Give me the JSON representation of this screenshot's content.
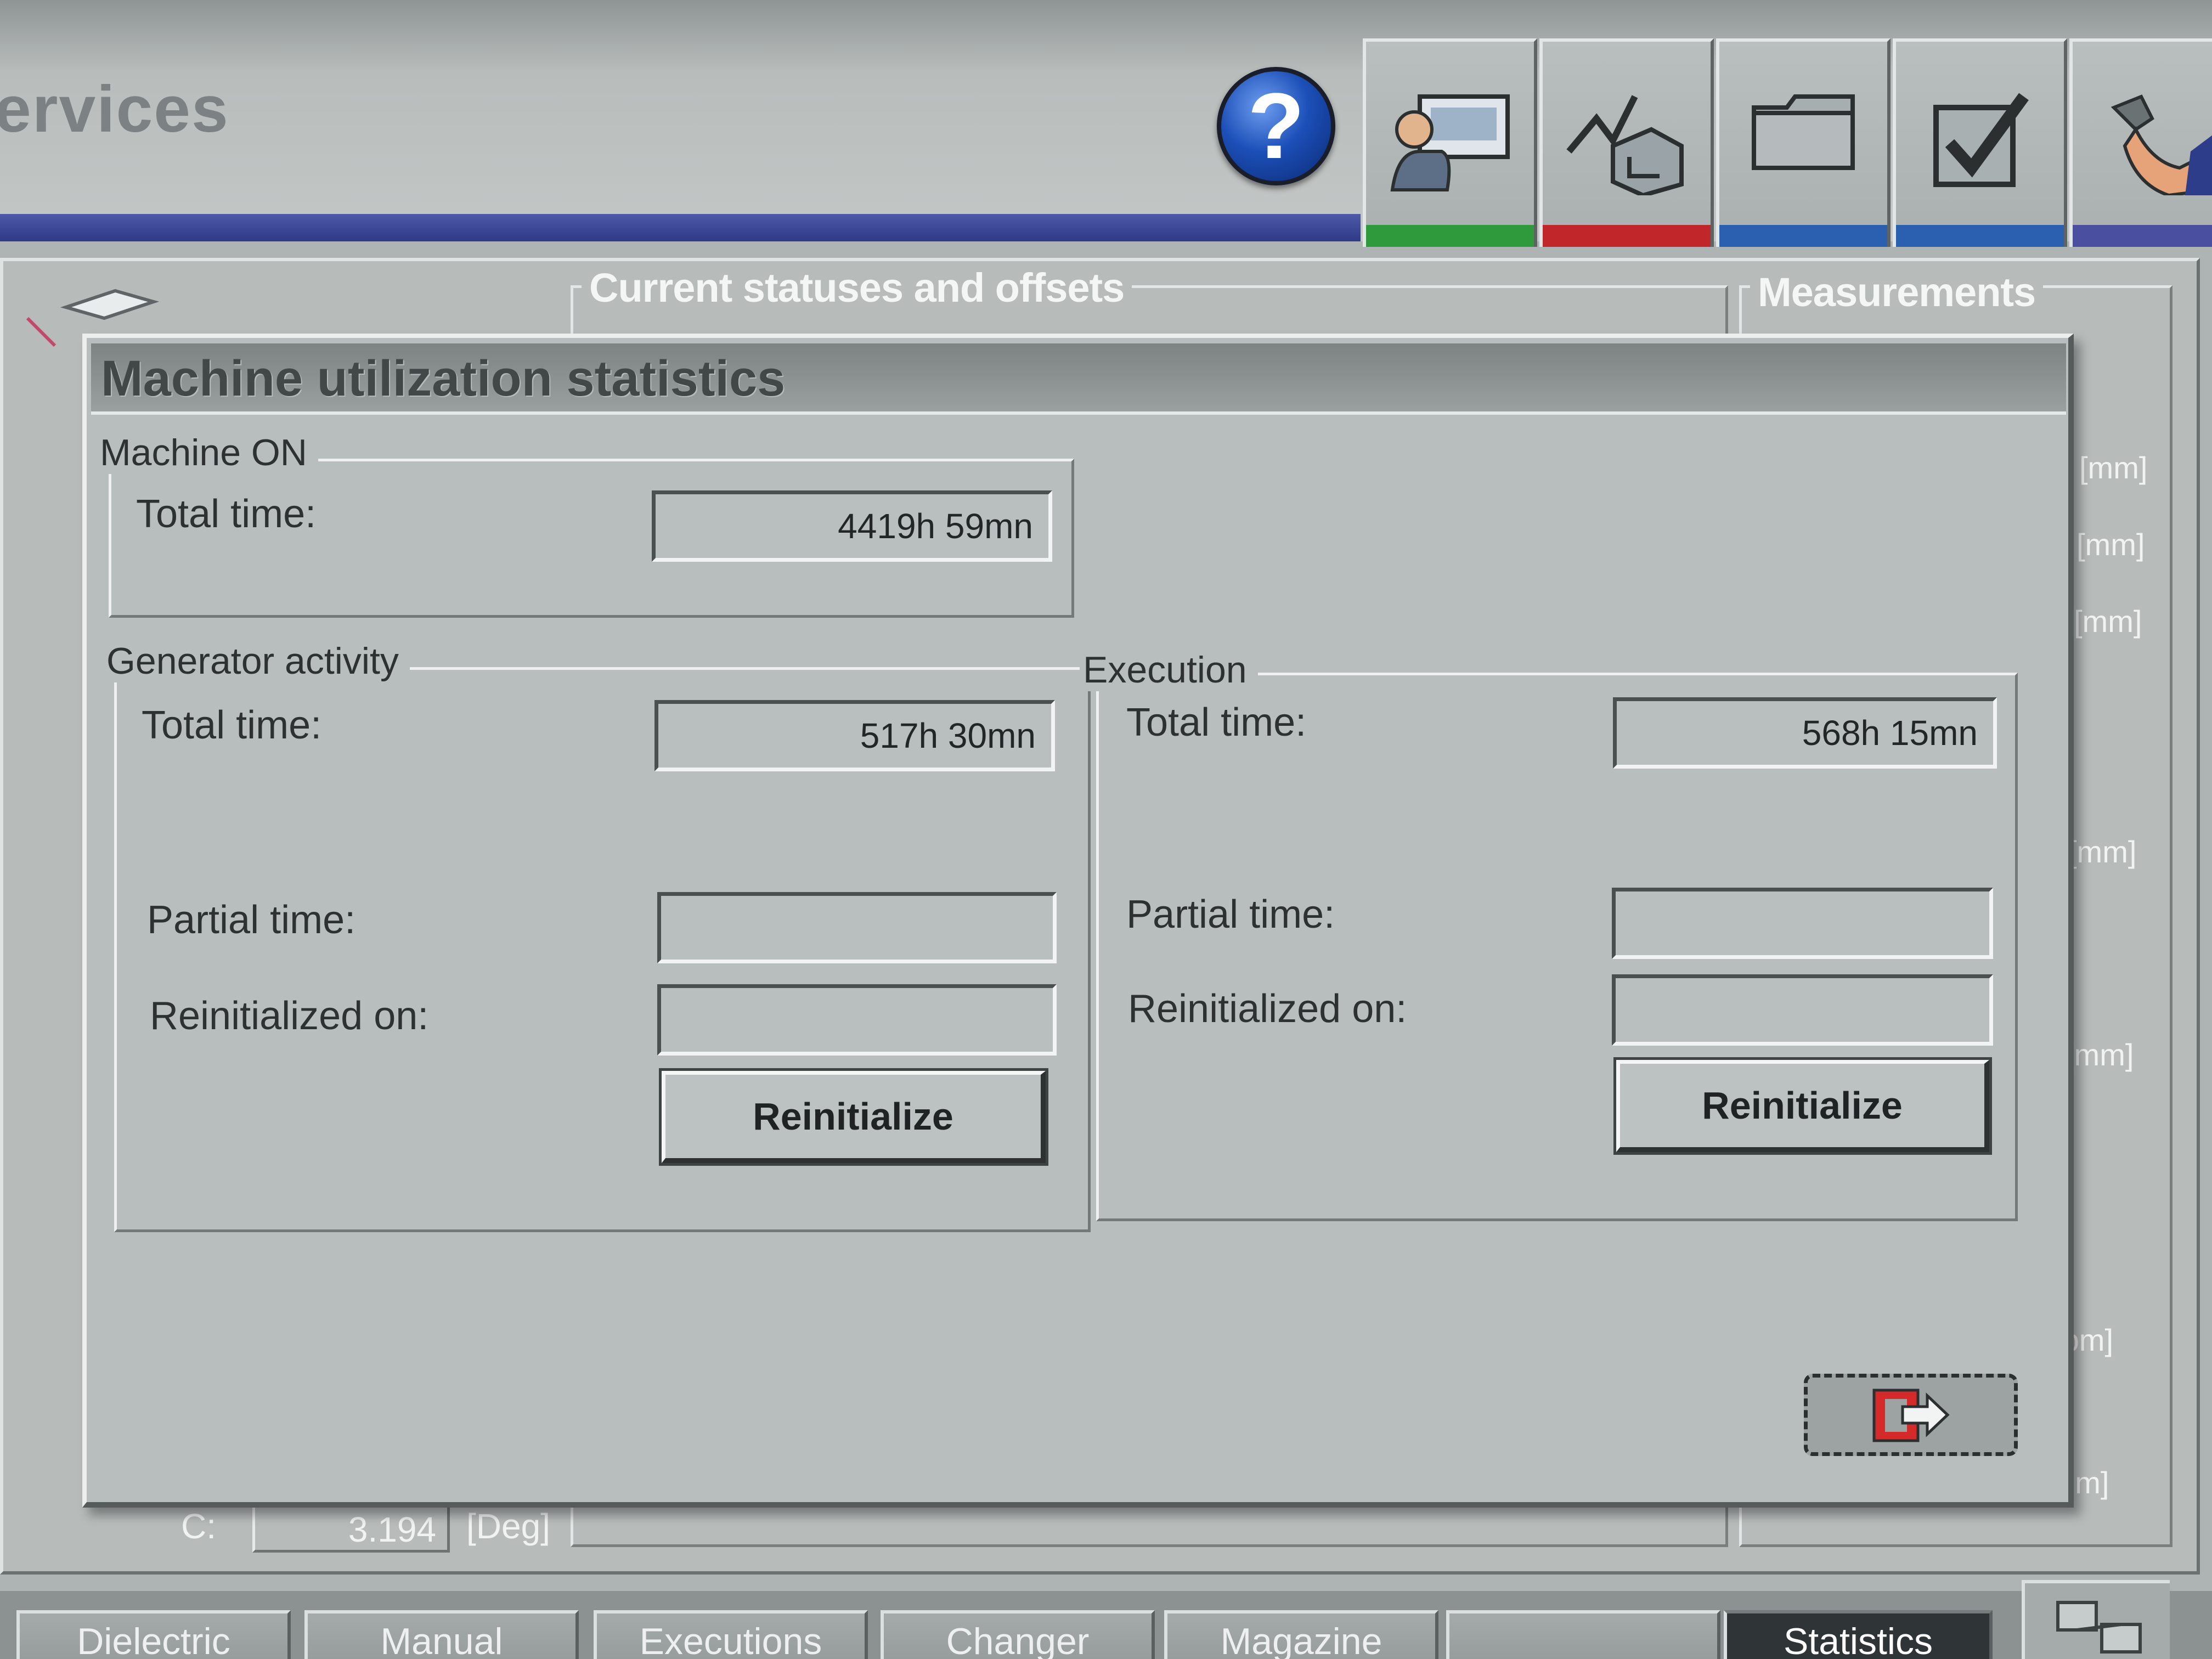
{
  "header": {
    "app_title": "ervices",
    "help_label": "?",
    "tools": [
      {
        "icon": "operator-console-icon",
        "color": "#2f9a3c"
      },
      {
        "icon": "machining-process-icon",
        "color": "#c0262a"
      },
      {
        "icon": "folder-icon",
        "color": "#2b5fb0"
      },
      {
        "icon": "checkbox-icon",
        "color": "#2b5fb0"
      },
      {
        "icon": "wrench-hand-icon",
        "color": "#4a4fa0"
      }
    ]
  },
  "background": {
    "group_current": "Current statuses and offsets",
    "group_measurements": "Measurements",
    "units": [
      "[mm]",
      "[mm]",
      "[mm]",
      "[mm]",
      "[mm]",
      "rpm]",
      "[mm]"
    ],
    "axis_c_label": "C:",
    "axis_c_value": "3.194",
    "axis_c_unit": "[Deg]"
  },
  "modal": {
    "title": "Machine utilization statistics",
    "machine_on": {
      "group_title": "Machine ON",
      "total_time_label": "Total time:",
      "total_time_value": "4419h 59mn"
    },
    "generator": {
      "group_title": "Generator activity",
      "total_time_label": "Total time:",
      "total_time_value": "517h 30mn",
      "partial_time_label": "Partial time:",
      "partial_time_value": "",
      "reinitialized_label": "Reinitialized on:",
      "reinitialized_value": "",
      "reinitialize_button": "Reinitialize"
    },
    "execution": {
      "group_title": "Execution",
      "total_time_label": "Total time:",
      "total_time_value": "568h 15mn",
      "partial_time_label": "Partial time:",
      "partial_time_value": "",
      "reinitialized_label": "Reinitialized on:",
      "reinitialized_value": "",
      "reinitialize_button": "Reinitialize"
    },
    "exit_icon": "exit-arrow-icon",
    "accent": "#d42a2a"
  },
  "tabs": [
    {
      "label": "Dielectric",
      "active": false
    },
    {
      "label": "Manual",
      "active": false
    },
    {
      "label": "Executions",
      "active": false
    },
    {
      "label": "Changer",
      "active": false
    },
    {
      "label": "Magazine",
      "active": false
    },
    {
      "label": "",
      "active": false
    },
    {
      "label": "Statistics",
      "active": true
    }
  ]
}
